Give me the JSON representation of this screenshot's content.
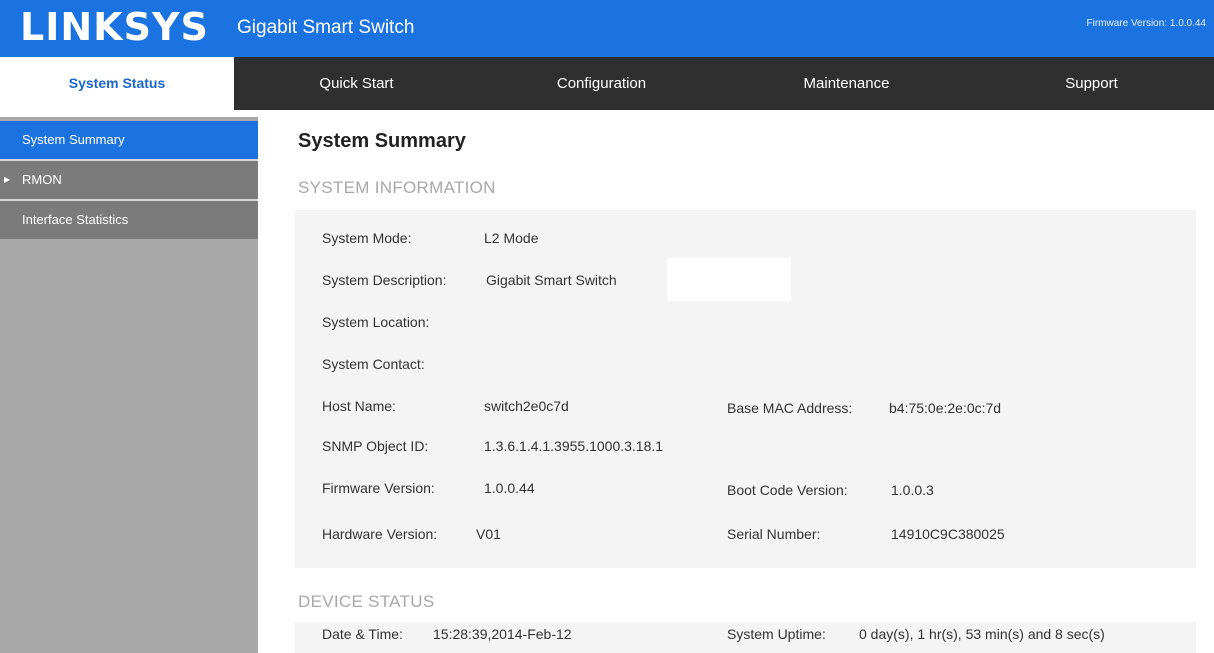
{
  "header": {
    "logo": "LINKSYS",
    "product": "Gigabit Smart Switch",
    "firmware_top": "Firmware Version: 1.0.0.44"
  },
  "nav": {
    "items": [
      {
        "label": "System Status",
        "active": true
      },
      {
        "label": "Quick Start"
      },
      {
        "label": "Configuration"
      },
      {
        "label": "Maintenance"
      },
      {
        "label": "Support"
      }
    ]
  },
  "sidebar": {
    "items": [
      {
        "label": "System Summary",
        "active": true
      },
      {
        "label": "RMON"
      },
      {
        "label": "Interface Statistics"
      }
    ]
  },
  "main": {
    "title": "System Summary",
    "system_info": {
      "heading": "SYSTEM INFORMATION",
      "system_mode_label": "System Mode:",
      "system_mode": "L2 Mode",
      "system_description_label": "System Description:",
      "system_description": "Gigabit Smart Switch",
      "system_location_label": "System Location:",
      "system_contact_label": "System Contact:",
      "host_name_label": "Host Name:",
      "host_name": "switch2e0c7d",
      "base_mac_label": "Base MAC Address:",
      "base_mac": "b4:75:0e:2e:0c:7d",
      "snmp_oid_label": "SNMP Object ID:",
      "snmp_oid": "1.3.6.1.4.1.3955.1000.3.18.1",
      "firmware_label": "Firmware Version:",
      "firmware": "1.0.0.44",
      "boot_code_label": "Boot Code Version:",
      "boot_code": "1.0.0.3",
      "hardware_label": "Hardware Version:",
      "hardware": "V01",
      "serial_label": "Serial Number:",
      "serial": "14910C9C380025"
    },
    "device_status": {
      "heading": "DEVICE STATUS",
      "date_time_label": "Date & Time:",
      "date_time": "15:28:39,2014-Feb-12",
      "uptime_label": "System Uptime:",
      "uptime": "0 day(s), 1 hr(s), 53 min(s) and 8 sec(s)"
    }
  },
  "colors": {
    "brand_blue": "#1a73e0",
    "nav_dark": "#2f2f2f",
    "sidebar_gray": "#a8a8a8",
    "sidebar_dark": "#7b7b7b",
    "panel_bg": "#f4f4f4"
  }
}
